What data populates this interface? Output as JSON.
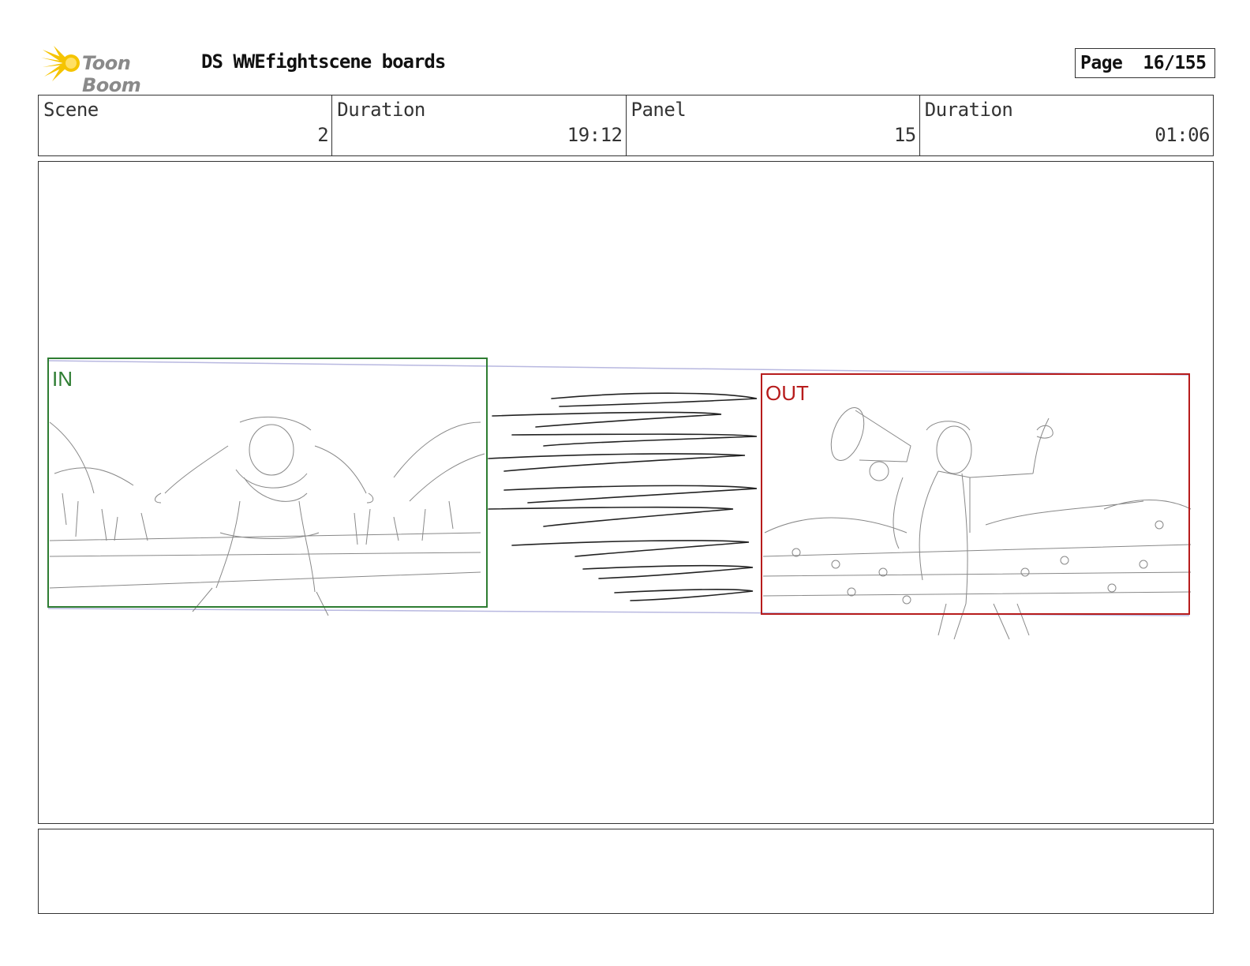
{
  "header": {
    "logo_text": "Toon Boom",
    "title": "DS WWEfightscene boards",
    "page_label": "Page",
    "page_value": "16/155"
  },
  "info": [
    {
      "label": "Scene",
      "value": "2"
    },
    {
      "label": "Duration",
      "value": "19:12"
    },
    {
      "label": "Panel",
      "value": "15"
    },
    {
      "label": "Duration",
      "value": "01:06"
    }
  ],
  "panel": {
    "in_label": "IN",
    "out_label": "OUT",
    "in_color": "#2e7d32",
    "out_color": "#b71c1c",
    "guide_color": "#b8b8e0"
  },
  "notes": ""
}
